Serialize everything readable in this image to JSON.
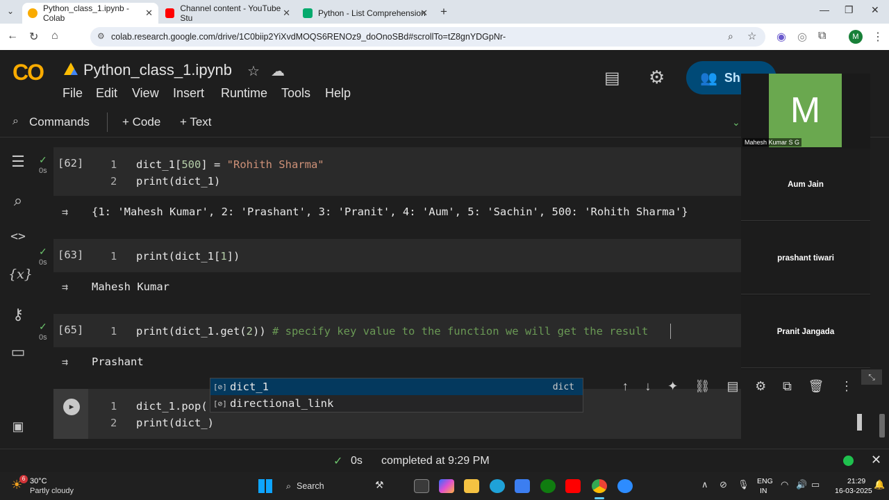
{
  "browser": {
    "tabs": [
      {
        "title": "Python_class_1.ipynb - Colab",
        "active": true
      },
      {
        "title": "Channel content - YouTube Stu",
        "active": false
      },
      {
        "title": "Python - List Comprehension",
        "active": false
      }
    ],
    "url": "colab.research.google.com/drive/1C0biip2YiXvdMOQS6RENOz9_doOnoSBd#scrollTo=tZ8gnYDGpNr-",
    "profile_initial": "M"
  },
  "colab": {
    "logo_text": "CO",
    "notebook_title": "Python_class_1.ipynb",
    "menu": [
      "File",
      "Edit",
      "View",
      "Insert",
      "Runtime",
      "Tools",
      "Help"
    ],
    "share_label": "Sh",
    "toolbar": {
      "commands": "Commands",
      "add_code": "+ Code",
      "add_text": "+ Text"
    }
  },
  "cells": [
    {
      "exec_count": "[62]",
      "duration": "0s",
      "lines": [
        {
          "n": "1",
          "code": "dict_1[500] = \"Rohith Sharma\""
        },
        {
          "n": "2",
          "code": "print(dict_1)"
        }
      ],
      "output": "{1: 'Mahesh Kumar', 2: 'Prashant', 3: 'Pranit', 4: 'Aum', 5: 'Sachin', 500: 'Rohith Sharma'}"
    },
    {
      "exec_count": "[63]",
      "duration": "0s",
      "lines": [
        {
          "n": "1",
          "code": "print(dict_1[1])"
        }
      ],
      "output": "Mahesh Kumar"
    },
    {
      "exec_count": "[65]",
      "duration": "0s",
      "lines": [
        {
          "n": "1",
          "code": "print(dict_1.get(2)) # specify key value to the function we will get the result"
        }
      ],
      "output": "Prashant"
    },
    {
      "exec_count": "",
      "duration": "",
      "lines": [
        {
          "n": "1",
          "code": "dict_1.pop("
        },
        {
          "n": "2",
          "code": "print(dict_)"
        }
      ],
      "output": ""
    }
  ],
  "autocomplete": [
    {
      "label": "dict_1",
      "kind": "dict",
      "selected": true
    },
    {
      "label": "directional_link",
      "kind": "",
      "selected": false
    }
  ],
  "status_bar": {
    "duration": "0s",
    "message": "completed at 9:29 PM"
  },
  "meeting": {
    "presenter_initial": "M",
    "presenter_name": "Mahesh Kumar S G",
    "participants": [
      "Aum Jain",
      "prashant tiwari",
      "Pranit Jangada"
    ]
  },
  "taskbar": {
    "weather_temp": "30°C",
    "weather_desc": "Partly cloudy",
    "weather_badge": "6",
    "search_label": "Search",
    "lang_top": "ENG",
    "lang_bottom": "IN",
    "time": "21:29",
    "date": "16-03-2025"
  },
  "colors": {
    "accent_blue": "#1a73e8",
    "selected_row": "#04395e",
    "presenter_tile": "#6aa84f"
  }
}
